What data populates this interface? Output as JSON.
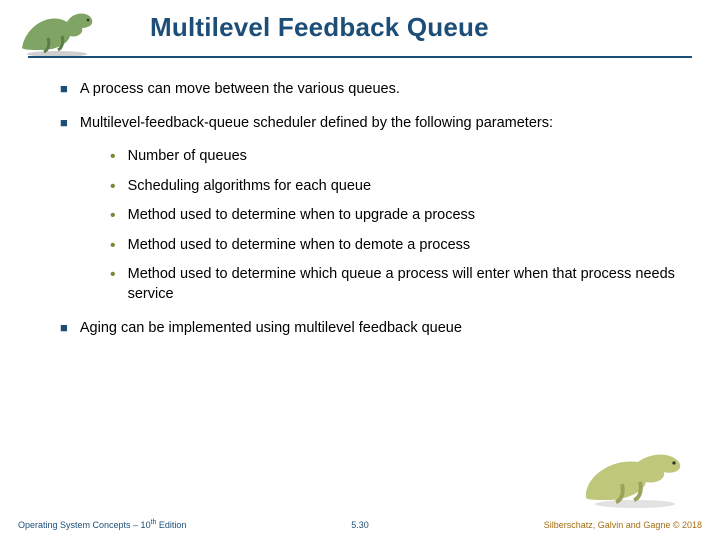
{
  "title": "Multilevel Feedback Queue",
  "bullets": {
    "b1": "A process can move between the various queues.",
    "b2": "Multilevel-feedback-queue scheduler defined by the following parameters:",
    "b3": "Aging can be implemented using multilevel feedback queue"
  },
  "sub": {
    "s1": "Number of queues",
    "s2": "Scheduling algorithms for each queue",
    "s3": "Method used to determine when to upgrade a process",
    "s4": "Method used to determine when to demote a process",
    "s5": "Method used to determine which queue a process will enter when that process needs service"
  },
  "footer": {
    "left_a": "Operating System Concepts – 10",
    "left_b": " Edition",
    "left_sup": "th",
    "center": "5.30",
    "right": "Silberschatz, Galvin and Gagne © 2018"
  }
}
